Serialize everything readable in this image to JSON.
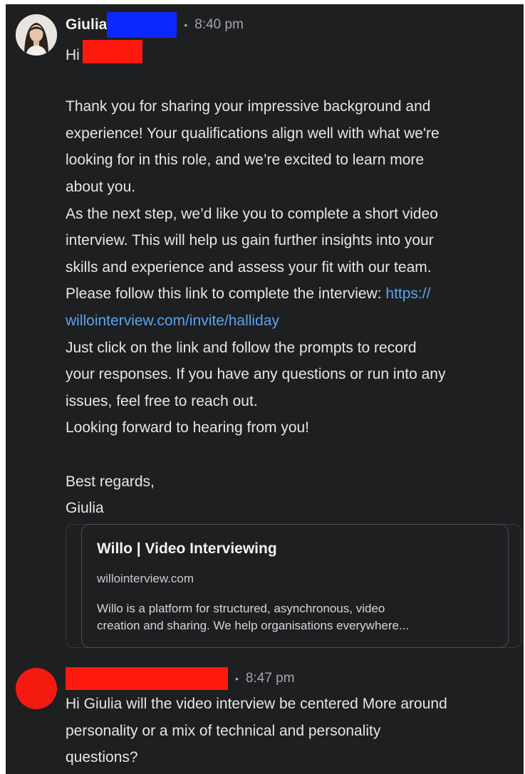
{
  "messages": [
    {
      "sender": "Giulia",
      "time": "8:40 pm",
      "separator": "•",
      "greeting": "Hi",
      "lines": [
        "Thank you for sharing your impressive background and",
        "experience! Your qualifications align well with what we're",
        "looking for in this role, and we’re excited to learn more",
        "about you.",
        "As the next step, we’d like you to complete a short video",
        "interview. This will help us gain further insights into your",
        "skills and experience and assess your fit with our team.",
        "Please follow this link to complete the interview:",
        "https://",
        "willointerview.com/invite/halliday",
        "Just click on the link and follow the prompts to record",
        "your responses. If you have any questions or run into any",
        "issues, feel free to reach out.",
        "Looking forward to hearing from you!",
        "Best regards,",
        "Giulia"
      ],
      "link_preview": {
        "title": "Willo | Video Interviewing",
        "domain": "willointerview.com",
        "description_lines": [
          "Willo is a platform for structured, asynchronous, video",
          "creation and sharing. We help organisations everywhere..."
        ]
      }
    },
    {
      "time": "8:47 pm",
      "separator": "•",
      "lines": [
        "Hi Giulia will the video interview be centered More around",
        "personality or a mix of technical and personality",
        "questions?"
      ]
    }
  ],
  "colors": {
    "background": "#1d1f21",
    "text": "#e4e6e8",
    "link": "#5ba3f0",
    "redaction_blue": "#0a28ff",
    "redaction_red": "#ff1a10"
  }
}
